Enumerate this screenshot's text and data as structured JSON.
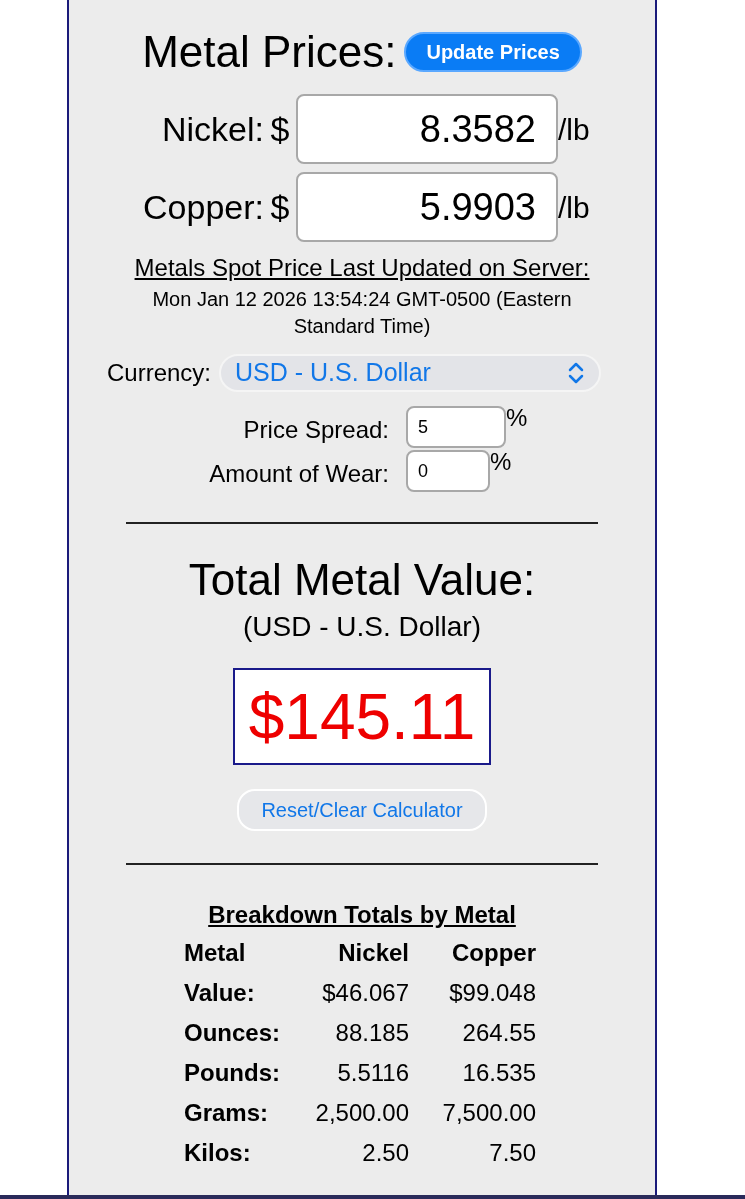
{
  "header": {
    "title": "Metal Prices:",
    "update_button": "Update Prices"
  },
  "prices": [
    {
      "metal": "Nickel:",
      "currency_symbol": "$",
      "value": "8.3582",
      "unit": "/lb"
    },
    {
      "metal": "Copper:",
      "currency_symbol": "$",
      "value": "5.9903",
      "unit": "/lb"
    }
  ],
  "last_updated": {
    "label": "Metals Spot Price Last Updated on Server:",
    "timestamp": "Mon Jan 12 2026 13:54:24 GMT-0500 (Eastern Standard Time)"
  },
  "currency": {
    "label": "Currency:",
    "value": "USD - U.S. Dollar"
  },
  "adjustments": [
    {
      "label": "Price Spread:",
      "value": "5",
      "unit": "%"
    },
    {
      "label": "Amount of Wear:",
      "value": "0",
      "unit": "%"
    }
  ],
  "total": {
    "title": "Total Metal Value:",
    "currency": "(USD - U.S. Dollar)",
    "value": "$145.11",
    "reset_button": "Reset/Clear Calculator"
  },
  "breakdown": {
    "title": "Breakdown Totals by Metal",
    "columns": [
      "Metal",
      "Nickel",
      "Copper"
    ],
    "rows": [
      [
        "Value:",
        "$46.067",
        "$99.048"
      ],
      [
        "Ounces:",
        "88.185",
        "264.55"
      ],
      [
        "Pounds:",
        "5.5116",
        "16.535"
      ],
      [
        "Grams:",
        "2,500.00",
        "7,500.00"
      ],
      [
        "Kilos:",
        "2.50",
        "7.50"
      ]
    ]
  }
}
